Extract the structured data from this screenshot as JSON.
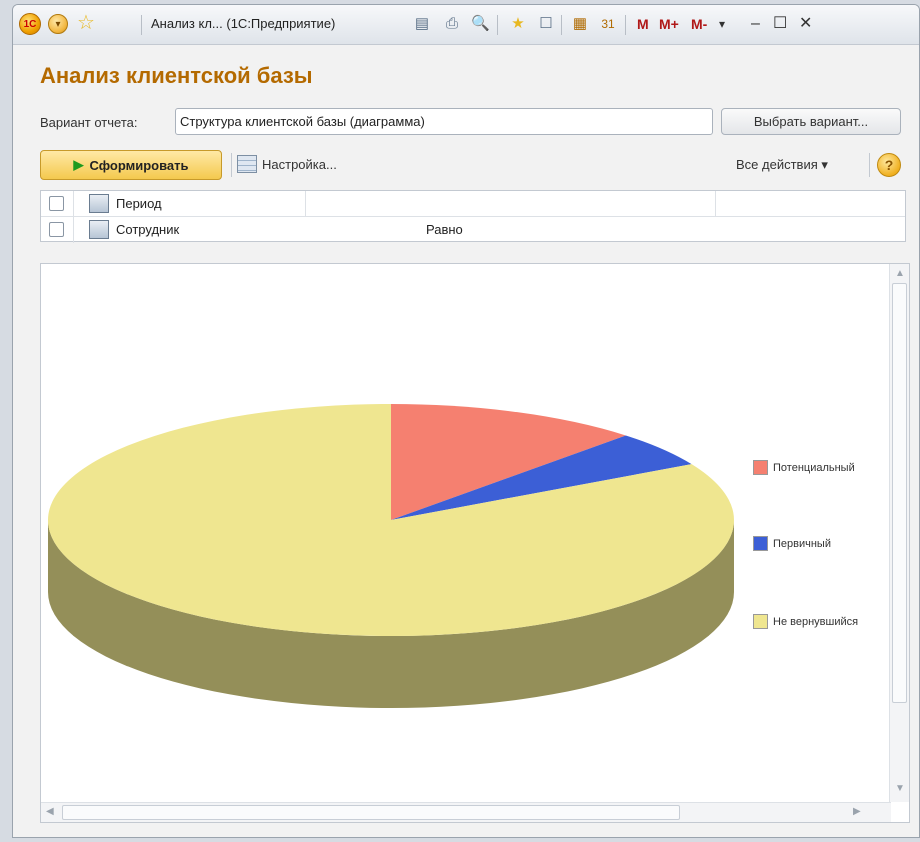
{
  "window": {
    "title": "Анализ кл... (1С:Предприятие)",
    "logo_text": "1С",
    "toolbar_m_labels": [
      "M",
      "M+",
      "M-"
    ]
  },
  "page": {
    "title": "Анализ клиентской базы"
  },
  "variant": {
    "label": "Вариант отчета:",
    "value": "Структура клиентской базы (диаграмма)",
    "choose_button": "Выбрать вариант..."
  },
  "command_bar": {
    "generate_button": "Сформировать",
    "settings_button": "Настройка...",
    "all_actions": "Все действия ▾",
    "help": "?"
  },
  "filters": [
    {
      "name": "Период",
      "condition": ""
    },
    {
      "name": "Сотрудник",
      "condition": "Равно"
    }
  ],
  "chart_data": {
    "type": "pie",
    "style": "3d",
    "series": [
      {
        "name": "Потенциальный",
        "value": 12,
        "color": "#f58070"
      },
      {
        "name": "Первичный",
        "value": 5,
        "color": "#3c5fd6"
      },
      {
        "name": "Не вернувшийся",
        "value": 83,
        "color": "#efe690"
      }
    ],
    "legend_position": "right"
  }
}
